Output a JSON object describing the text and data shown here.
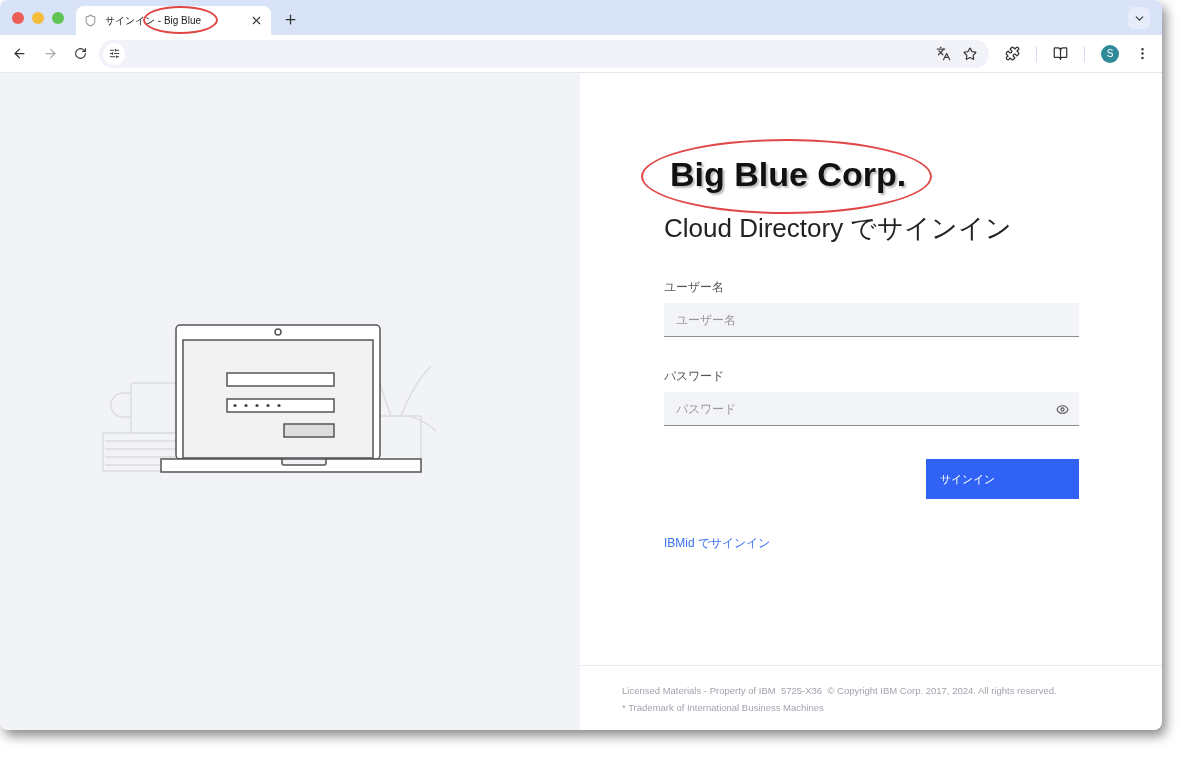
{
  "browser": {
    "tabs": [
      {
        "title": "サインイン - Big Blue",
        "selected": true
      }
    ],
    "profile_initial": "S"
  },
  "login": {
    "logo": "Big Blue Corp.",
    "heading": "Cloud Directory でサインイン",
    "fields": [
      {
        "kind": "text",
        "label": "ユーザー名",
        "placeholder": "ユーザー名"
      },
      {
        "kind": "password",
        "label": "パスワード",
        "placeholder": "パスワード"
      }
    ],
    "submit": "サインイン",
    "alt_link": "IBMid でサインイン"
  },
  "footer": [
    "Licensed Materials - Property of IBM  5725-X36  © Copyright IBM Corp. 2017, 2024. All rights reserved.",
    "* Trademark of International Business Machines"
  ]
}
